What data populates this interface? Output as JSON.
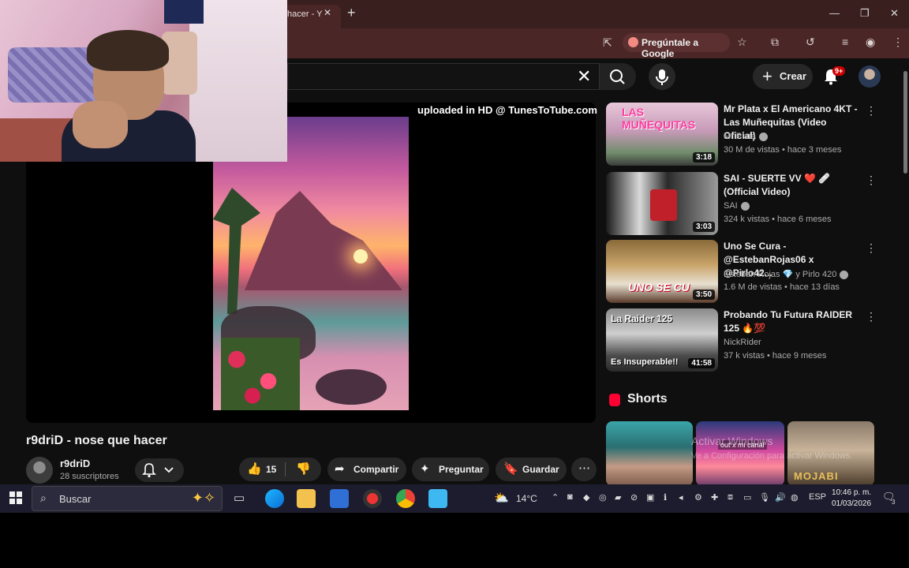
{
  "browser": {
    "tab_title": "hacer - Y",
    "ask_google": "Pregúntale a Google"
  },
  "youtube": {
    "create_label": "Crear",
    "notification_count": "9+",
    "player_overlay": "uploaded in HD @ TunesToTube.com",
    "video_title": "r9driD - nose que hacer",
    "channel_name": "r9driD",
    "channel_subs": "28 suscriptores",
    "likes": "15",
    "share_label": "Compartir",
    "ask_label": "Preguntar",
    "save_label": "Guardar"
  },
  "recommendations": [
    {
      "title": "Mr Plata x El Americano 4KT - Las Muñequitas (Video Oficial)",
      "channel": "Mr Plata",
      "meta": "30 M de vistas • hace 3 meses",
      "duration": "3:18",
      "thumb_text": "LAS MUÑEQUITAS"
    },
    {
      "title": "SAI - SUERTE VV ❤️ 🩹 (Official Video)",
      "channel": "SAI",
      "meta": "324 k vistas • hace 6 meses",
      "duration": "3:03",
      "thumb_text": ""
    },
    {
      "title": "Uno Se Cura - @EstebanRojas06 x @Pirlo42...",
      "channel": "Esteban Rojas 💎 y Pirlo 420",
      "meta": "1.6 M de vistas • hace 13 días",
      "duration": "3:50",
      "thumb_text": "UNO SE CU"
    },
    {
      "title": "Probando Tu Futura RAIDER 125 🔥💯",
      "channel": "NickRider",
      "meta": "37 k vistas • hace 9 meses",
      "duration": "41:58",
      "thumb_text": "La Raider 125"
    }
  ],
  "rec4_thumb_bottom": "Es Insuperable!!",
  "shorts": {
    "heading": "Shorts",
    "short2_text": "out x mi canal",
    "short3_text": "MOJABI"
  },
  "watermark": {
    "line1": "Activar Windows",
    "line2": "Ve a Configuración para activar Windows."
  },
  "taskbar": {
    "search_placeholder": "Buscar",
    "weather": "14°C",
    "lang": "ESP",
    "time": "10:46 p. m.",
    "date": "01/03/2026",
    "notif_count": "3"
  },
  "colors": {
    "yt_bg": "#0f0f0f",
    "chrome_tab": "#3a1f1f",
    "accent_red": "#ff0033"
  }
}
